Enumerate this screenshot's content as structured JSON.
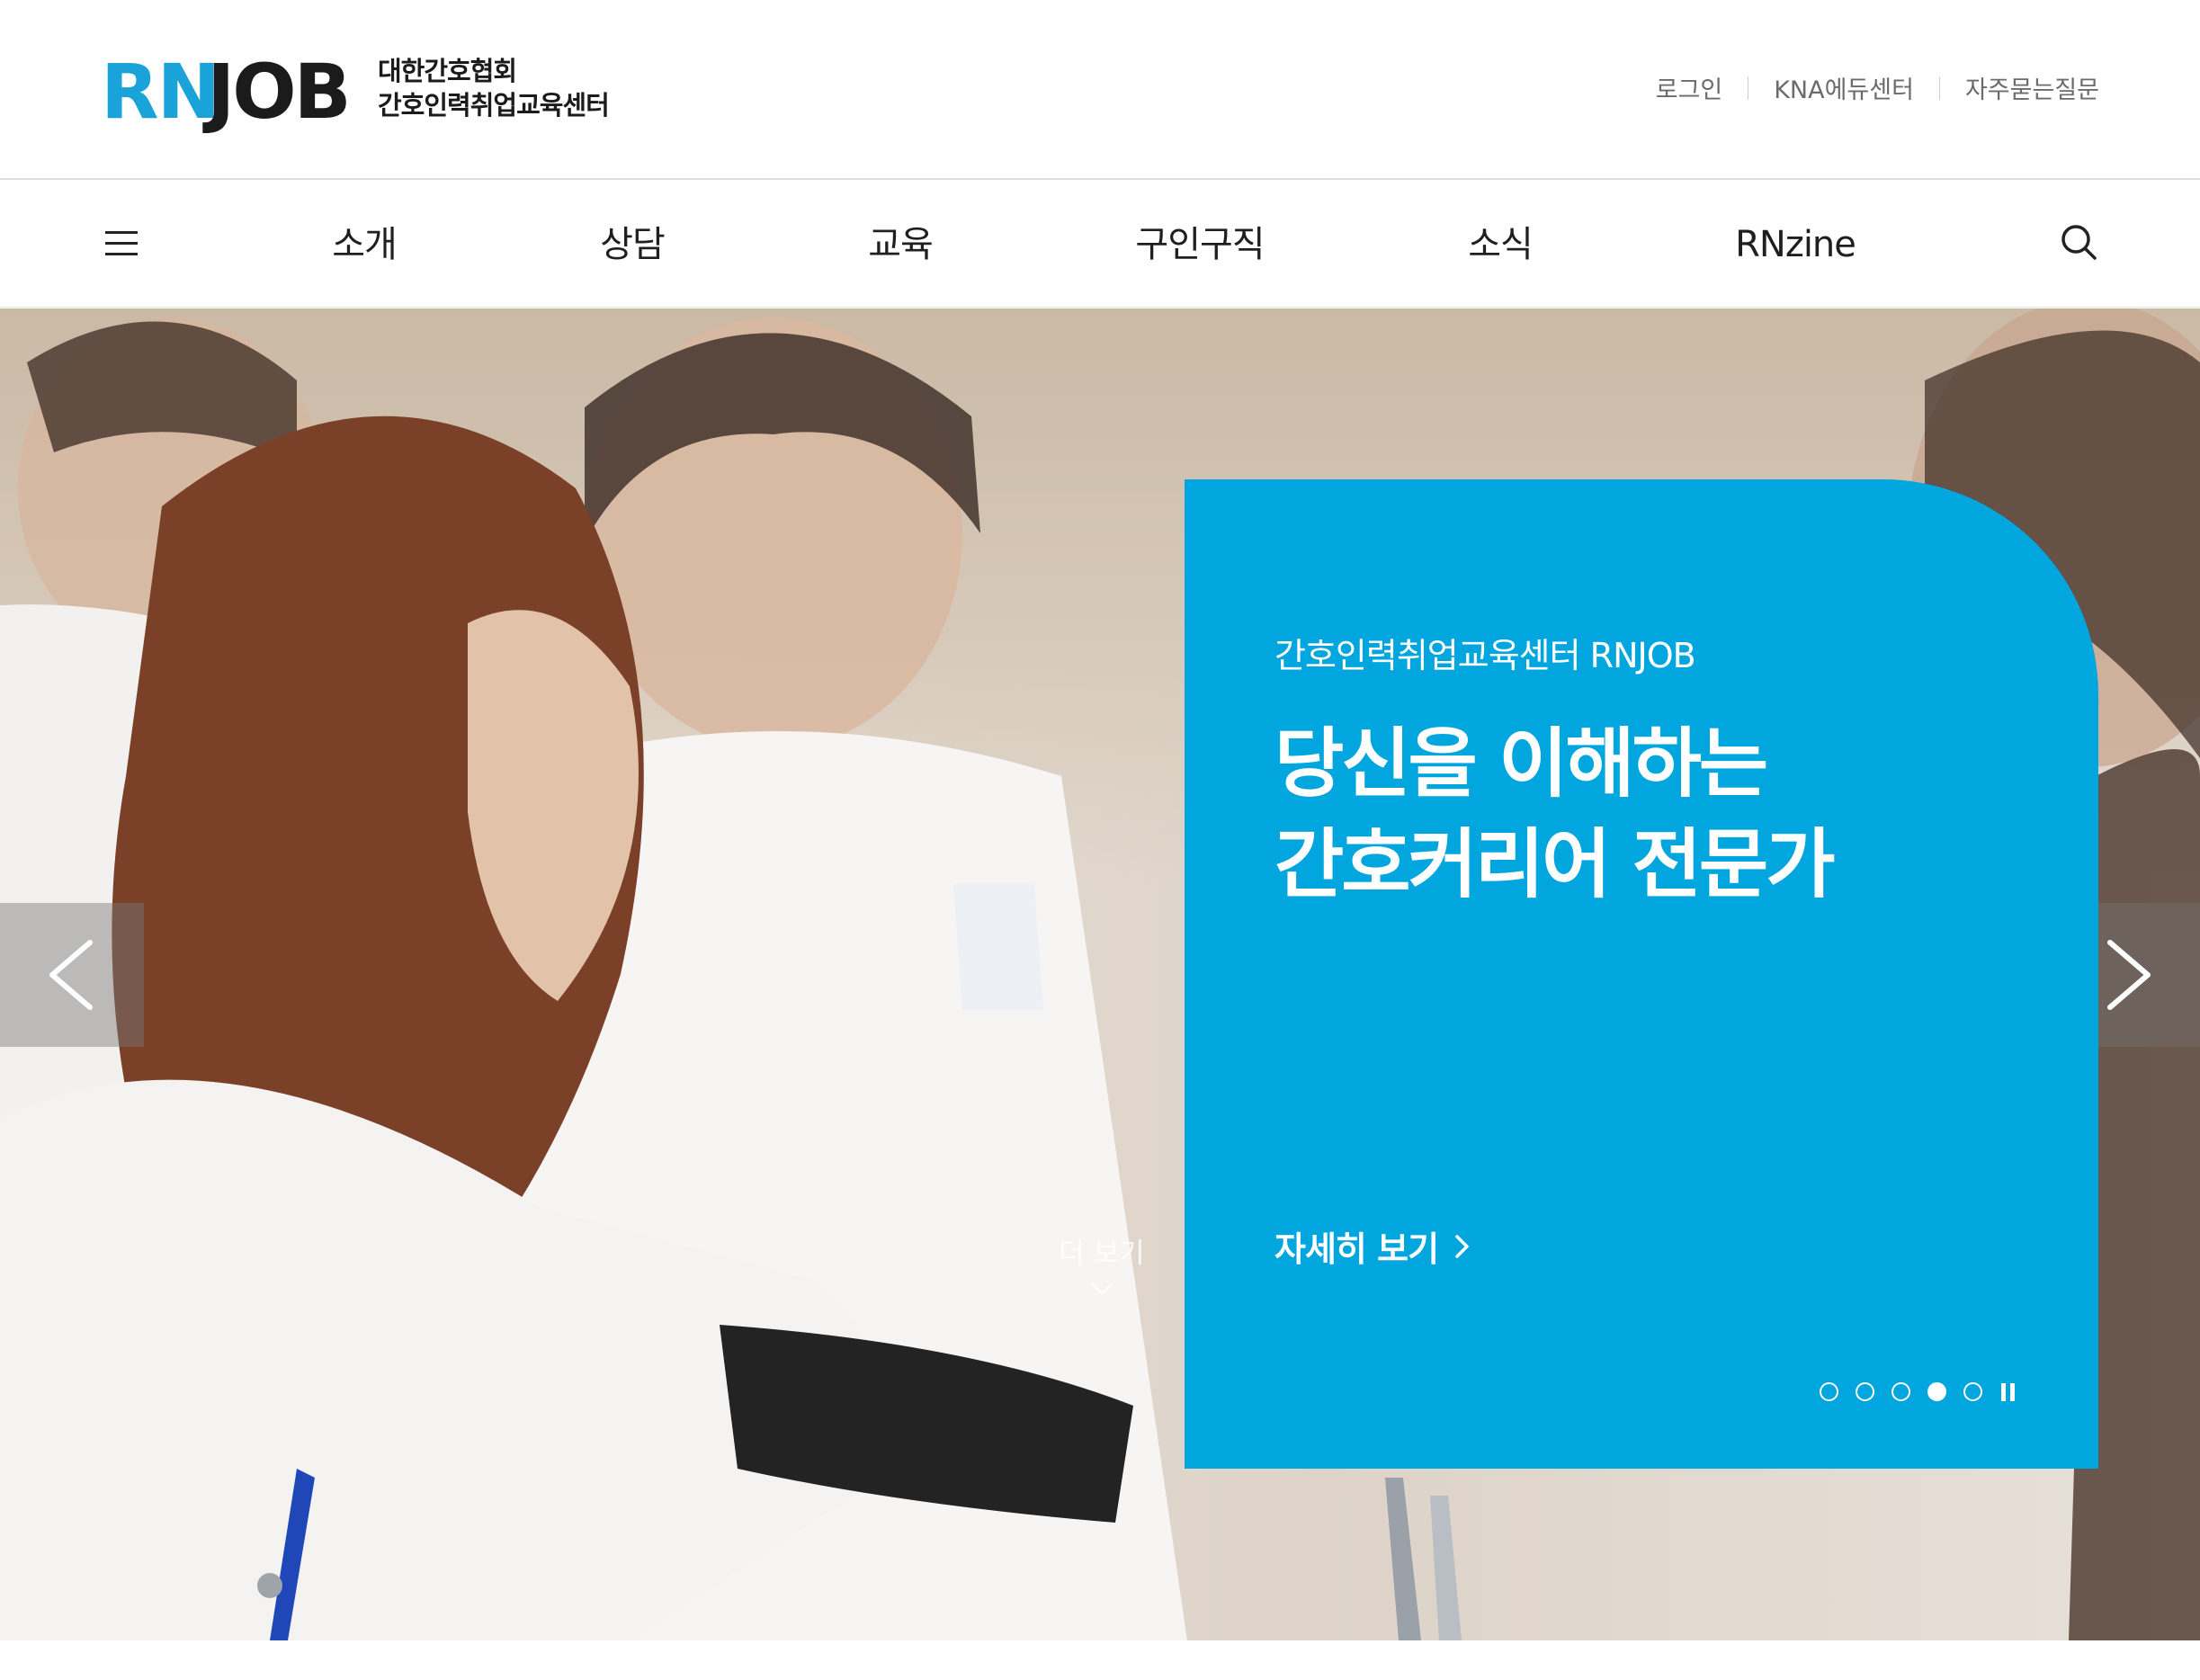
{
  "header": {
    "logo": {
      "brand_rn": "RN",
      "brand_job": "JOB",
      "org_line1": "대한간호협회",
      "org_line2": "간호인력취업교육센터"
    },
    "util_links": [
      "로그인",
      "KNA에듀센터",
      "자주묻는질문"
    ]
  },
  "gnb": {
    "items": [
      "소개",
      "상담",
      "교육",
      "구인구직",
      "소식",
      "RNzine"
    ],
    "menu_icon": "hamburger-icon",
    "search_icon": "search-icon"
  },
  "hero": {
    "card": {
      "eyebrow": "간호인력취업교육센터 RNJOB",
      "title_line1": "당신을 이해하는",
      "title_line2": "간호커리어 전문가",
      "more_label": "자세히 보기",
      "color": "#00a6dd"
    },
    "slides": {
      "total": 5,
      "active": 4
    },
    "prev_icon": "chevron-left-icon",
    "next_icon": "chevron-right-icon",
    "scroll_more": "더 보기"
  },
  "colors": {
    "brand_blue": "#1aa3d9",
    "accent_card": "#00a6dd",
    "text_dark": "#1b1b1b"
  }
}
